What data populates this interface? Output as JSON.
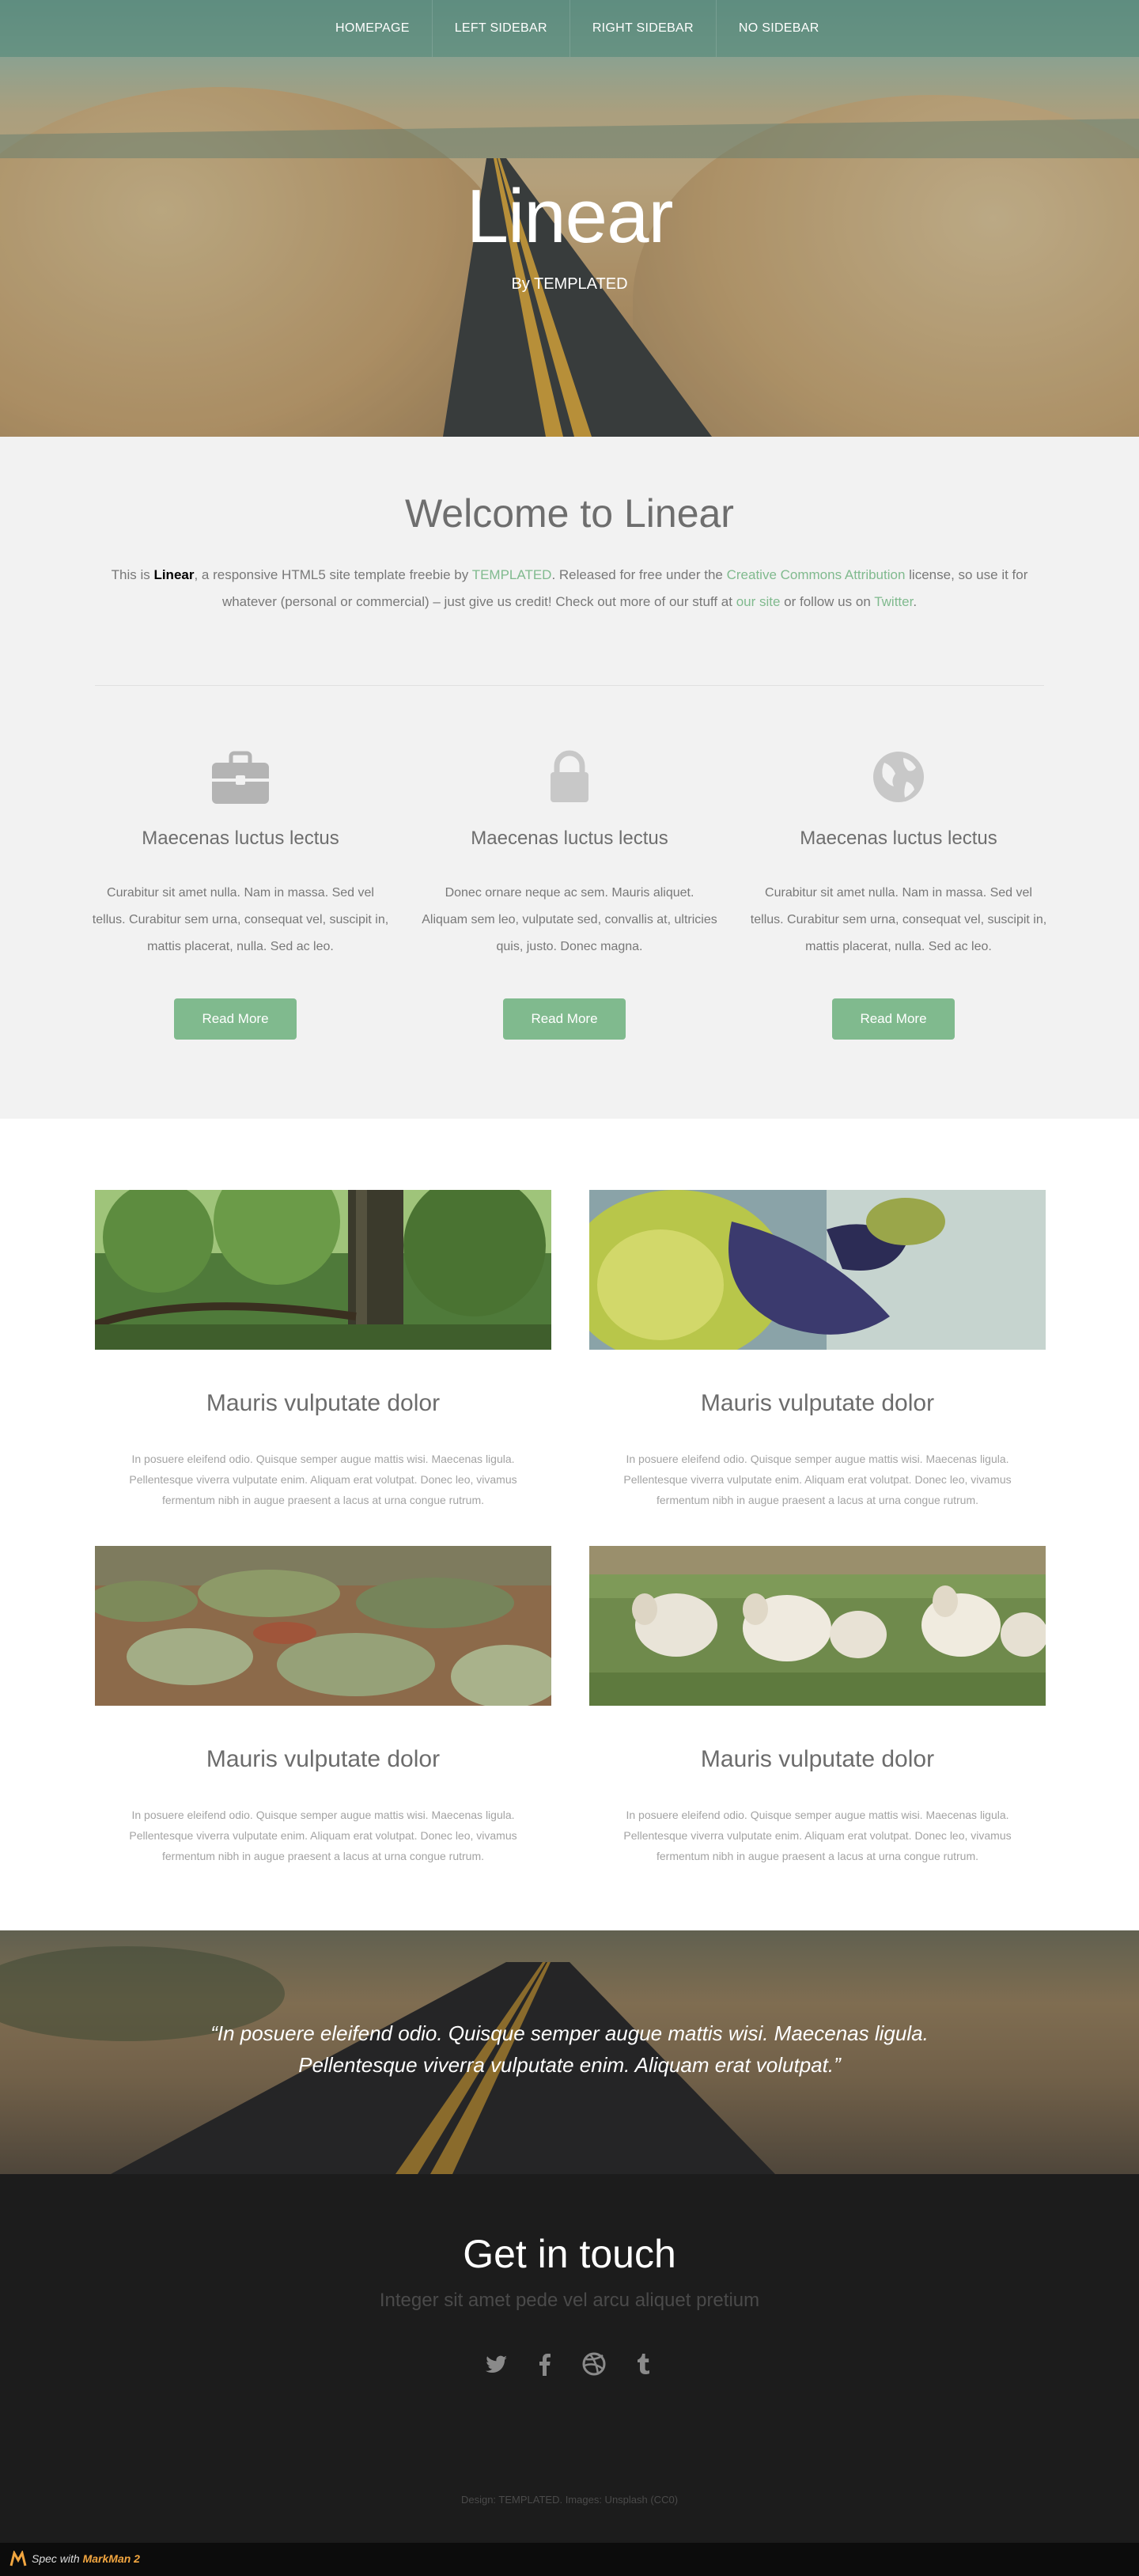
{
  "nav": {
    "items": [
      "HOMEPAGE",
      "LEFT SIDEBAR",
      "RIGHT SIDEBAR",
      "NO SIDEBAR"
    ]
  },
  "hero": {
    "title": "Linear",
    "subtitle": "By TEMPLATED"
  },
  "welcome": {
    "title": "Welcome to Linear",
    "intro": {
      "t1": "This is ",
      "brand": "Linear",
      "t2": ", a responsive HTML5 site template freebie by ",
      "link1": "TEMPLATED",
      "t3": ". Released for free under the ",
      "link2": "Creative Commons Attribution",
      "t4": " license, so use it for whatever (personal or commercial) – just give us credit! Check out more of our stuff at ",
      "link3": "our site",
      "t5": " or follow us on ",
      "link4": "Twitter",
      "t6": "."
    }
  },
  "features": [
    {
      "icon": "briefcase-icon",
      "title": "Maecenas luctus lectus",
      "text": "Curabitur sit amet nulla. Nam in massa. Sed vel tellus. Curabitur sem urna, consequat vel, suscipit in, mattis placerat, nulla. Sed ac leo.",
      "button": "Read More"
    },
    {
      "icon": "lock-icon",
      "title": "Maecenas luctus lectus",
      "text": "Donec ornare neque ac sem. Mauris aliquet. Aliquam sem leo, vulputate sed, convallis at, ultricies quis, justo. Donec magna.",
      "button": "Read More"
    },
    {
      "icon": "globe-icon",
      "title": "Maecenas luctus lectus",
      "text": "Curabitur sit amet nulla. Nam in massa. Sed vel tellus. Curabitur sem urna, consequat vel, suscipit in, mattis placerat, nulla. Sed ac leo.",
      "button": "Read More"
    }
  ],
  "cards": [
    {
      "image": "forest-photo",
      "title": "Mauris vulputate dolor",
      "text": "In posuere eleifend odio. Quisque semper augue mattis wisi. Maecenas ligula. Pellentesque viverra vulputate enim. Aliquam erat volutpat. Donec leo, vivamus fermentum nibh in augue praesent a lacus at urna congue rutrum."
    },
    {
      "image": "leaf-photo",
      "title": "Mauris vulputate dolor",
      "text": "In posuere eleifend odio. Quisque semper augue mattis wisi. Maecenas ligula. Pellentesque viverra vulputate enim. Aliquam erat volutpat. Donec leo, vivamus fermentum nibh in augue praesent a lacus at urna congue rutrum."
    },
    {
      "image": "shrubland-photo",
      "title": "Mauris vulputate dolor",
      "text": "In posuere eleifend odio. Quisque semper augue mattis wisi. Maecenas ligula. Pellentesque viverra vulputate enim. Aliquam erat volutpat. Donec leo, vivamus fermentum nibh in augue praesent a lacus at urna congue rutrum."
    },
    {
      "image": "sheep-photo",
      "title": "Mauris vulputate dolor",
      "text": "In posuere eleifend odio. Quisque semper augue mattis wisi. Maecenas ligula. Pellentesque viverra vulputate enim. Aliquam erat volutpat. Donec leo, vivamus fermentum nibh in augue praesent a lacus at urna congue rutrum."
    }
  ],
  "quote": {
    "text": "“In posuere eleifend odio. Quisque semper augue mattis wisi. Maecenas ligula. Pellentesque viverra vulputate enim. Aliquam erat volutpat.”"
  },
  "footer": {
    "title": "Get in touch",
    "lead": "Integer sit amet pede vel arcu aliquet pretium",
    "social": [
      "twitter-icon",
      "facebook-icon",
      "dribbble-icon",
      "tumblr-icon"
    ],
    "copyright": "Design: TEMPLATED.   Images: Unsplash (CC0)"
  },
  "badge": {
    "prefix": "Spec with ",
    "product": "MarkMan 2"
  },
  "colors": {
    "accent": "#80ba8e",
    "background_light": "#f2f2f2",
    "heading": "#6e6e6e",
    "body_text": "#787878",
    "card_text": "#a3a3a3",
    "footer_bg": "#1c1c1c"
  }
}
